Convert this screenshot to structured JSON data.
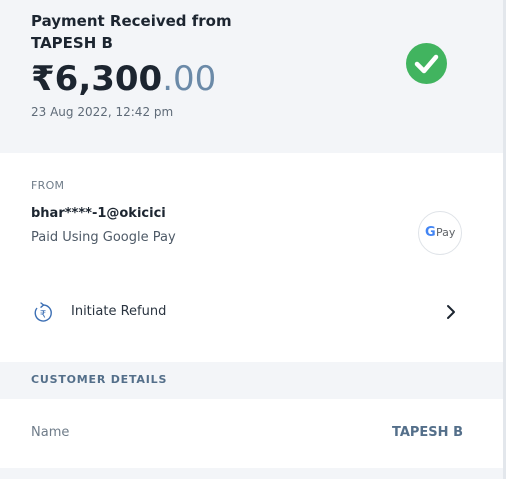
{
  "payment": {
    "title_line1": "Payment Received from",
    "title_line2": "TAPESH B",
    "amount_main": "₹6,300",
    "amount_decimal": ".00",
    "datetime": "23 Aug 2022, 12:42 pm",
    "status_icon": "check-circle-icon",
    "status_color": "#41b45f"
  },
  "from": {
    "label": "FROM",
    "vpa": "bhar****-1@okicici",
    "method": "Paid Using Google Pay",
    "app_logo_g": "G",
    "app_logo_text": "Pay"
  },
  "refund": {
    "label": "Initiate Refund",
    "icon": "refund-rupee-icon",
    "chevron": "chevron-right-icon"
  },
  "customer": {
    "section_title": "CUSTOMER DETAILS",
    "name_label": "Name",
    "name_value": "TAPESH B"
  }
}
